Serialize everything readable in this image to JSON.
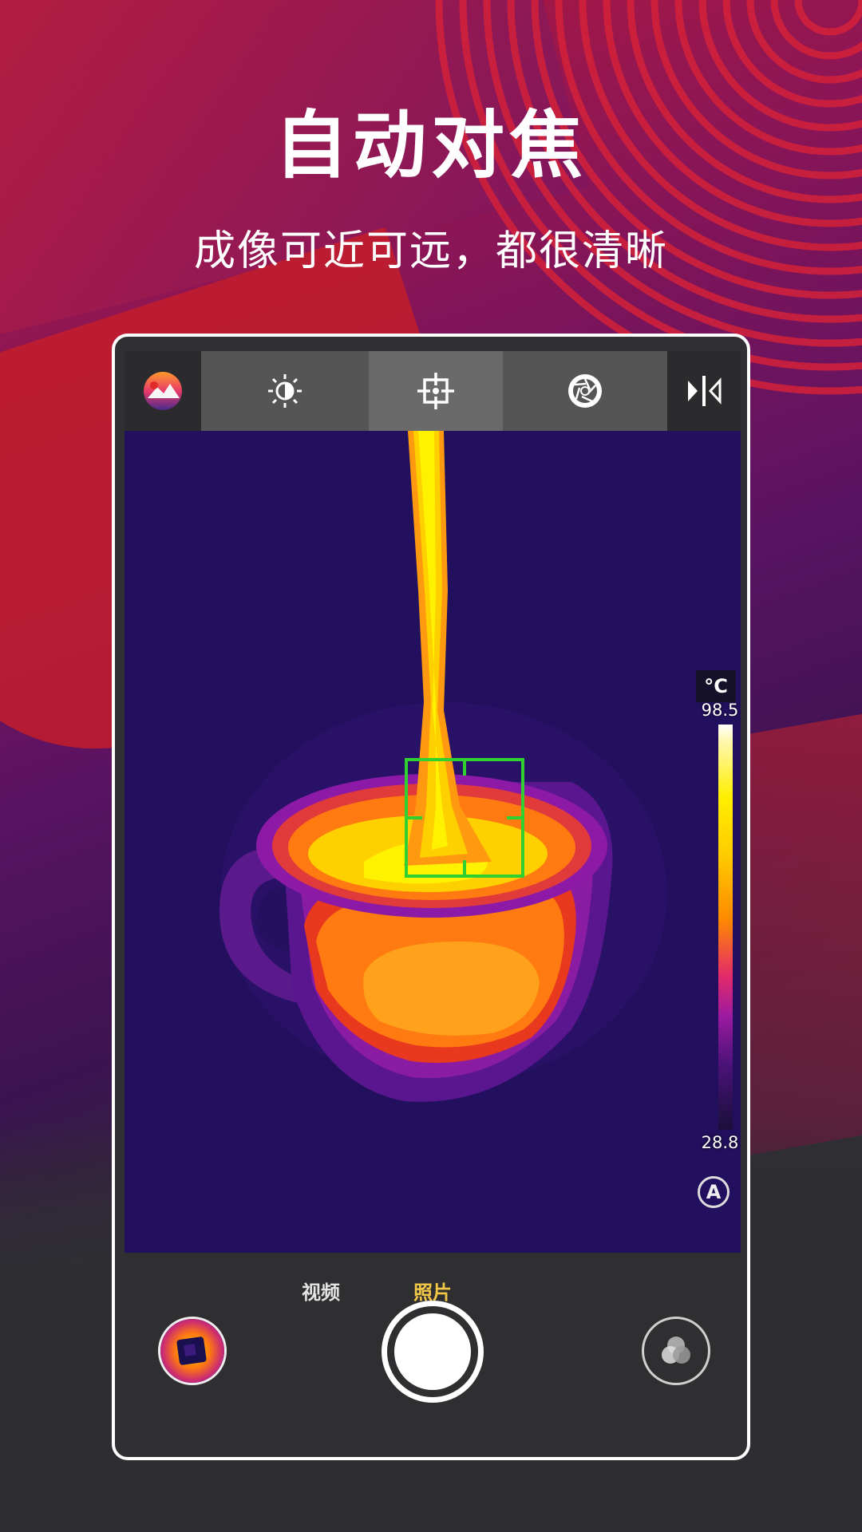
{
  "headline": {
    "title": "自动对焦",
    "subtitle": "成像可近可远，都很清晰"
  },
  "toolbar": {
    "items": [
      {
        "icon": "palette-icon"
      },
      {
        "icon": "brightness-icon"
      },
      {
        "icon": "focus-target-icon",
        "selected": true
      },
      {
        "icon": "shutter-icon"
      },
      {
        "icon": "mirror-icon"
      }
    ]
  },
  "temperature_scale": {
    "unit": "°C",
    "max": "98.5",
    "min": "28.8",
    "mode_badge": "A"
  },
  "capture_modes": {
    "video": "视频",
    "photo": "照片",
    "active": "photo"
  },
  "colors": {
    "focus_box": "#2fd02f",
    "active_mode": "#f3c847",
    "thermal_background": "#22105e"
  }
}
